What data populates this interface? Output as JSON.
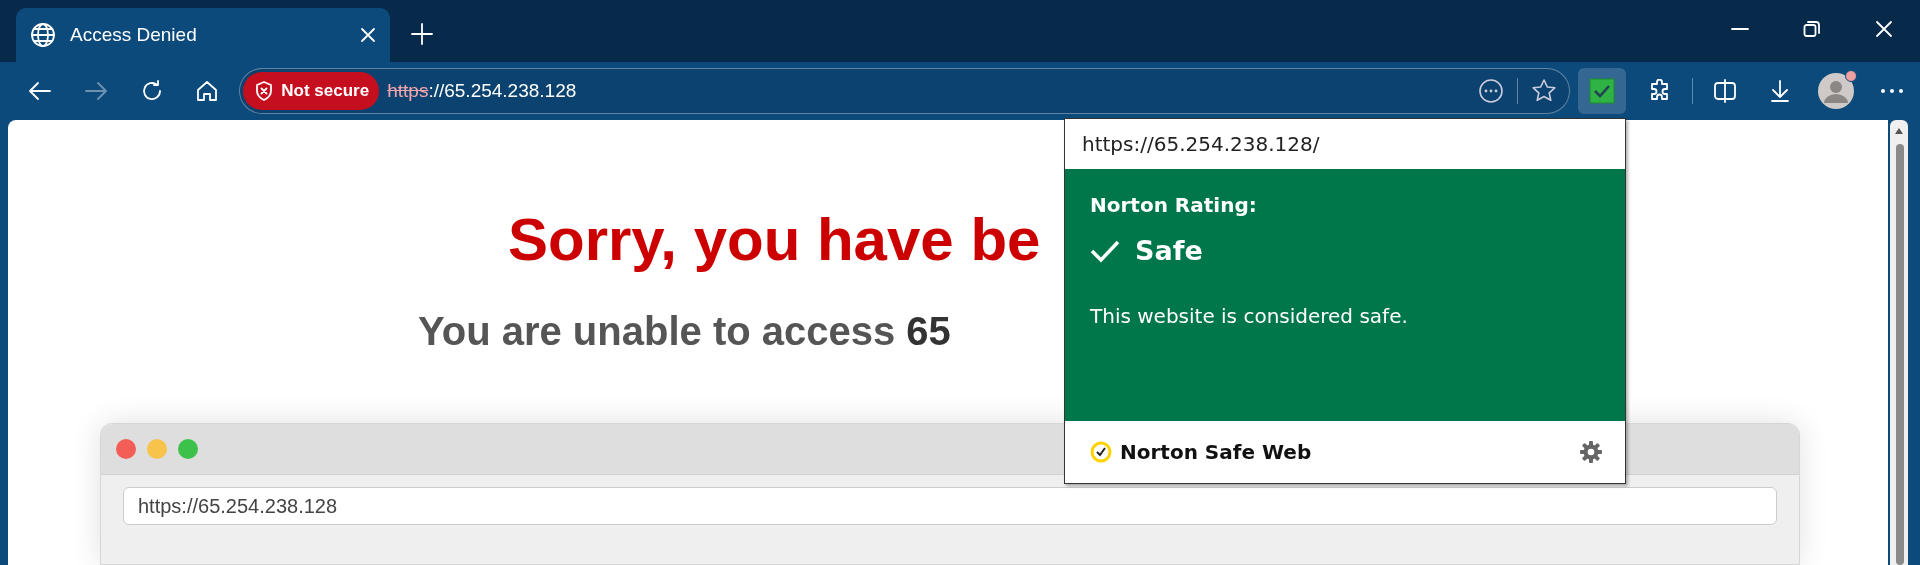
{
  "tabs": [
    {
      "title": "Access Denied",
      "selected": true
    }
  ],
  "navigation": {
    "forward_disabled": true
  },
  "address_bar": {
    "security_label": "Not secure",
    "scheme": "https",
    "rest": "://65.254.238.128"
  },
  "norton_extension": {
    "active": true
  },
  "page": {
    "heading": "Sorry, you have be",
    "subheading": "You are unable to access **65**",
    "mock_window": {
      "url": "https://65.254.238.128"
    }
  },
  "norton_popup": {
    "url": "https://65.254.238.128/",
    "rating_label": "Norton Rating:",
    "rating": "Safe",
    "message": "This website is considered safe.",
    "footer": "Norton Safe Web"
  }
}
